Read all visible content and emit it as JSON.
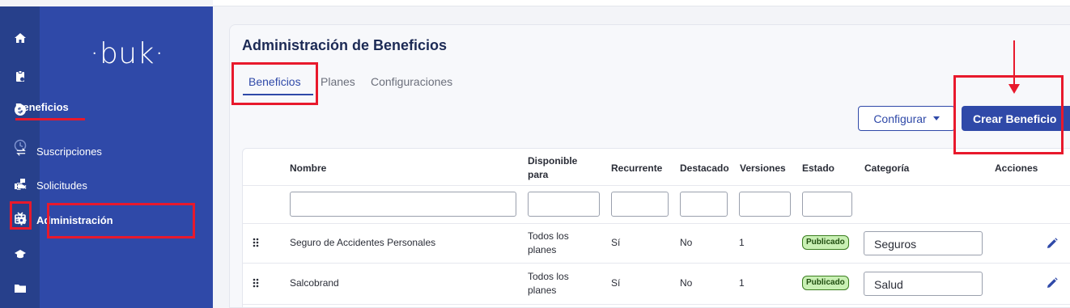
{
  "brand": {
    "logo_text": "·buk·"
  },
  "sidebar": {
    "section_title": "Beneficios",
    "items": [
      {
        "label": "Suscripciones",
        "icon": "arrows-swap-icon"
      },
      {
        "label": "Solicitudes",
        "icon": "list-shuffle-icon"
      },
      {
        "label": "Administración",
        "icon": "gear-icon"
      }
    ]
  },
  "rail_icons": [
    "home-icon",
    "clipboard-icon",
    "dollar-coin-icon",
    "clock-icon",
    "hand-benefit-icon",
    "gift-icon",
    "graduation-cap-icon",
    "folder-icon"
  ],
  "page": {
    "title": "Administración de Beneficios",
    "tabs": [
      {
        "label": "Beneficios",
        "active": true
      },
      {
        "label": "Planes",
        "active": false
      },
      {
        "label": "Configuraciones",
        "active": false
      }
    ],
    "configure_button": "Configurar",
    "create_button": "Crear Beneficio"
  },
  "table": {
    "columns": {
      "nombre": "Nombre",
      "disponible_1": "Disponible",
      "disponible_2": "para",
      "recurrente": "Recurrente",
      "destacado": "Destacado",
      "versiones": "Versiones",
      "estado": "Estado",
      "categoria": "Categoría",
      "acciones": "Acciones"
    },
    "rows": [
      {
        "nombre": "Seguro de Accidentes Personales",
        "disponible_1": "Todos los",
        "disponible_2": "planes",
        "recurrente": "Sí",
        "destacado": "No",
        "versiones": "1",
        "estado": "Publicado",
        "categoria": "Seguros"
      },
      {
        "nombre": "Salcobrand",
        "disponible_1": "Todos los",
        "disponible_2": "planes",
        "recurrente": "Sí",
        "destacado": "No",
        "versiones": "1",
        "estado": "Publicado",
        "categoria": "Salud"
      }
    ]
  },
  "colors": {
    "sidebar": "#2f49a8",
    "rail": "#27408b",
    "primary": "#2f49a8",
    "annotation_red": "#e8192c",
    "badge_bg": "#c9f0b4"
  }
}
